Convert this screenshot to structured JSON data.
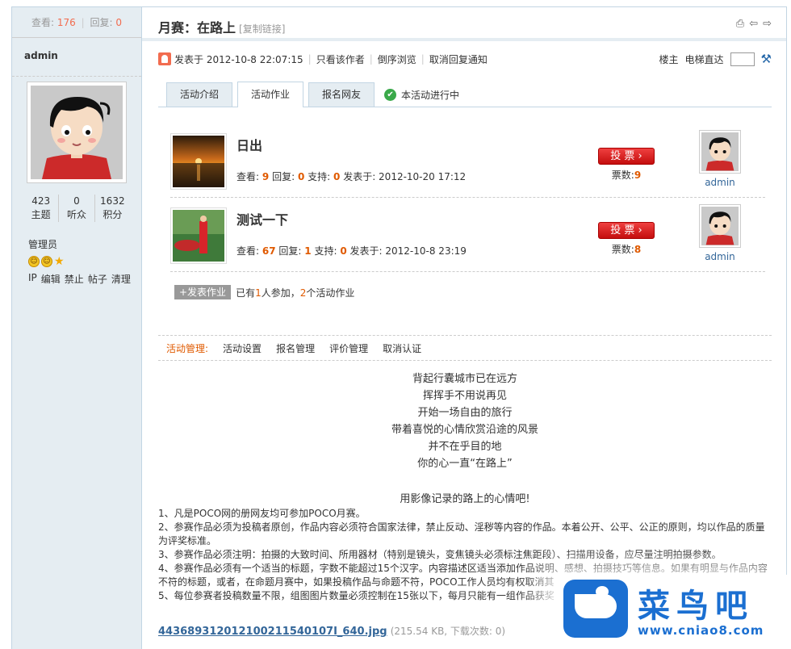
{
  "sidebar": {
    "views_label": "查看:",
    "views": "176",
    "sep": "|",
    "replies_label": "回复:",
    "replies": "0",
    "author": "admin",
    "stats": [
      {
        "num": "423",
        "label": "主题"
      },
      {
        "num": "0",
        "label": "听众"
      },
      {
        "num": "1632",
        "label": "积分"
      }
    ],
    "role": "管理员",
    "ops": [
      "IP",
      "编辑",
      "禁止",
      "帖子",
      "清理"
    ]
  },
  "thread": {
    "title": "月赛：在路上",
    "copy_link": "[复制链接]",
    "posted": "发表于 2012-10-8 22:07:15",
    "only_author": "只看该作者",
    "reverse": "倒序浏览",
    "cancel_notify": "取消回复通知",
    "floor": "楼主",
    "jump": "电梯直达"
  },
  "tabs": [
    "活动介绍",
    "活动作业",
    "报名网友"
  ],
  "status": "本活动进行中",
  "works": [
    {
      "title": "日出",
      "views_label": "查看:",
      "views": "9",
      "replies_label": "回复:",
      "replies": "0",
      "support_label": "支持:",
      "support": "0",
      "posted": "发表于: 2012-10-20 17:12",
      "vote": "投 票",
      "votes_label": "票数:",
      "votes": "9",
      "author": "admin"
    },
    {
      "title": "测试一下",
      "views_label": "查看:",
      "views": "67",
      "replies_label": "回复:",
      "replies": "1",
      "support_label": "支持:",
      "support": "0",
      "posted": "发表于: 2012-10-8 23:19",
      "vote": "投 票",
      "votes_label": "票数:",
      "votes": "8",
      "author": "admin"
    }
  ],
  "post_work": {
    "button": "+发表作业",
    "text1": "已有",
    "people": "1",
    "text2": "人参加，",
    "works": "2",
    "text3": "个活动作业"
  },
  "management": {
    "label": "活动管理:",
    "items": [
      "活动设置",
      "报名管理",
      "评价管理",
      "取消认证"
    ]
  },
  "poem": [
    "背起行囊城市已在远方",
    "挥挥手不用说再见",
    "开始一场自由的旅行",
    "带着喜悦的心情欣赏沿途的风景",
    "并不在乎目的地",
    "你的心一直“在路上”"
  ],
  "headline": "用影像记录的路上的心情吧!",
  "rules": [
    "1、凡是POCO网的册网友均可参加POCO月赛。",
    "2、参赛作品必须为投稿者原创，作品内容必须符合国家法律，禁止反动、淫秽等内容的作品。本着公开、公平、公正的原则，均以作品的质量为评奖标准。",
    "3、参赛作品必须注明：拍摄的大致时间、所用器材（特别是镜头，变焦镜头必须标注焦距段）、扫描用设备，应尽量注明拍摄参数。",
    "4、参赛作品必须有一个适当的标题，字数不能超过15个汉字。内容描述区适当添加作品说明、感想、拍摄技巧等信息。如果有明显与作品内容不符的标题，或者，在命题月赛中，如果投稿作品与命题不符，POCO工作人员均有权取消其",
    "5、每位参赛者投稿数量不限，组图图片数量必须控制在15张以下，每月只能有一组作品获奖"
  ],
  "attachment": {
    "name": "443689312012100211540107I_640.jpg",
    "info": "(215.54 KB, 下载次数: 0)"
  },
  "watermark": {
    "cn": "菜鸟吧",
    "url": "www.cniao8.com"
  },
  "colors": {
    "accent": "#e05a00",
    "link": "#336699",
    "sidebar_bg": "#e5edf2",
    "vote_red": "#d01818"
  }
}
